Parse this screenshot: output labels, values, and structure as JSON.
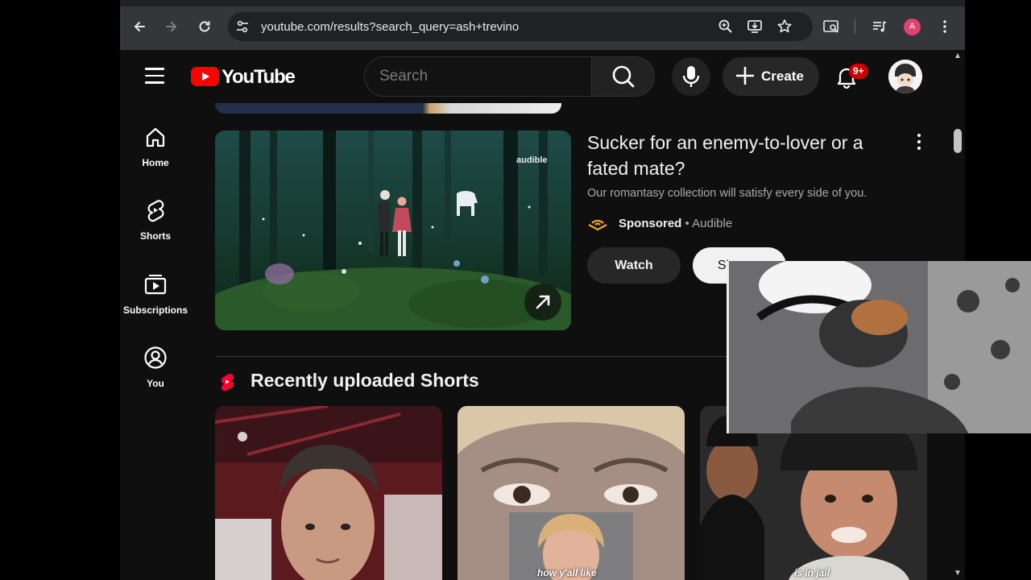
{
  "browser": {
    "url": "youtube.com/results?search_query=ash+trevino",
    "profile_initial": "A",
    "icons": [
      "back-icon",
      "forward-icon",
      "reload-icon",
      "site-info-icon",
      "zoom-icon",
      "install-app-icon",
      "bookmark-star-icon",
      "tab-search-icon",
      "media-control-icon",
      "menu-kebab-icon"
    ]
  },
  "header": {
    "logo_text": "YouTube",
    "search_placeholder": "Search",
    "create_label": "Create",
    "notification_badge": "9+"
  },
  "sidebar": {
    "items": [
      {
        "label": "Home",
        "icon": "home-icon"
      },
      {
        "label": "Shorts",
        "icon": "shorts-icon"
      },
      {
        "label": "Subscriptions",
        "icon": "subscriptions-icon"
      },
      {
        "label": "You",
        "icon": "you-icon"
      }
    ]
  },
  "ad": {
    "title": "Sucker for an enemy-to-lover or a fated mate?",
    "description": "Our romantasy collection will satisfy every side of you.",
    "sponsored_label": "Sponsored",
    "advertiser": "Audible",
    "separator": "•",
    "watermark": "audible",
    "watch_label": "Watch",
    "signup_label": "Sign up"
  },
  "shorts_section": {
    "title": "Recently uploaded Shorts",
    "items": [
      {
        "caption": ""
      },
      {
        "caption": "how y'all like"
      },
      {
        "caption": "is in jail"
      }
    ]
  },
  "colors": {
    "background": "#0f0f0f",
    "brand_red": "#ff0000",
    "chrome": "#35363a",
    "text": "#f1f1f1",
    "secondary_text": "#aaaaaa"
  }
}
